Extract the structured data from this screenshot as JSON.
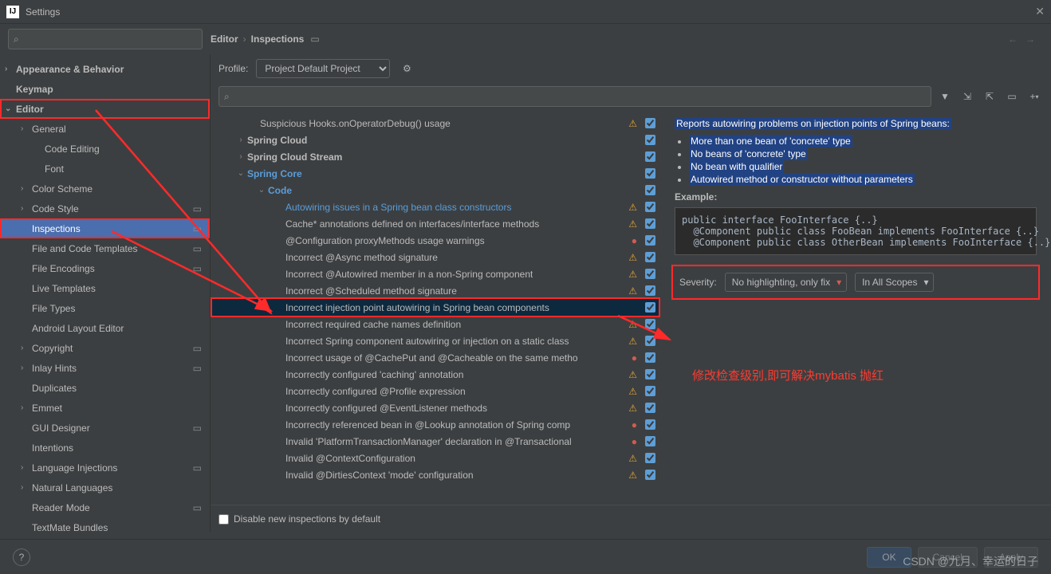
{
  "title": "Settings",
  "breadcrumbs": {
    "a": "Editor",
    "b": "Inspections"
  },
  "profile": {
    "label": "Profile:",
    "selected": "Project Default  Project"
  },
  "sidebar": {
    "items": [
      {
        "label": "Appearance & Behavior",
        "bold": true,
        "chev": ">"
      },
      {
        "label": "Keymap",
        "bold": true
      },
      {
        "label": "Editor",
        "bold": true,
        "chev": "v",
        "red": true
      },
      {
        "label": "General",
        "sub": 1,
        "chev": ">"
      },
      {
        "label": "Code Editing",
        "sub": 2
      },
      {
        "label": "Font",
        "sub": 2
      },
      {
        "label": "Color Scheme",
        "sub": 1,
        "chev": ">"
      },
      {
        "label": "Code Style",
        "sub": 1,
        "chev": ">",
        "gear": true
      },
      {
        "label": "Inspections",
        "sub": 1,
        "selected": true,
        "red": true,
        "gear": true
      },
      {
        "label": "File and Code Templates",
        "sub": 1,
        "gear": true
      },
      {
        "label": "File Encodings",
        "sub": 1,
        "gear": true
      },
      {
        "label": "Live Templates",
        "sub": 1
      },
      {
        "label": "File Types",
        "sub": 1
      },
      {
        "label": "Android Layout Editor",
        "sub": 1
      },
      {
        "label": "Copyright",
        "sub": 1,
        "chev": ">",
        "gear": true
      },
      {
        "label": "Inlay Hints",
        "sub": 1,
        "chev": ">",
        "gear": true
      },
      {
        "label": "Duplicates",
        "sub": 1
      },
      {
        "label": "Emmet",
        "sub": 1,
        "chev": ">"
      },
      {
        "label": "GUI Designer",
        "sub": 1,
        "gear": true
      },
      {
        "label": "Intentions",
        "sub": 1
      },
      {
        "label": "Language Injections",
        "sub": 1,
        "chev": ">",
        "gear": true
      },
      {
        "label": "Natural Languages",
        "sub": 1,
        "chev": ">"
      },
      {
        "label": "Reader Mode",
        "sub": 1,
        "gear": true
      },
      {
        "label": "TextMate Bundles",
        "sub": 1
      }
    ]
  },
  "tree": [
    {
      "label": "Suspicious Hooks.onOperatorDebug() usage",
      "pad": 1,
      "badge": "warn",
      "chk": true
    },
    {
      "label": "Spring Cloud",
      "pad": 0,
      "bold": true,
      "chev": ">",
      "chk": true
    },
    {
      "label": "Spring Cloud Stream",
      "pad": 0,
      "bold": true,
      "chev": ">",
      "chk": true
    },
    {
      "label": "Spring Core",
      "pad": 0,
      "bold": true,
      "chev": "v",
      "link": true,
      "chk": true
    },
    {
      "label": "Code",
      "pad": 4,
      "bold": true,
      "chev": "v",
      "link": true,
      "chk": true
    },
    {
      "label": "Autowiring issues in a Spring bean class constructors",
      "pad": 3,
      "link": true,
      "badge": "warn",
      "chk": true
    },
    {
      "label": "Cache* annotations defined on interfaces/interface methods",
      "pad": 3,
      "badge": "warn",
      "chk": true
    },
    {
      "label": "@Configuration proxyMethods usage warnings",
      "pad": 3,
      "badge": "err",
      "chk": true
    },
    {
      "label": "Incorrect @Async method signature",
      "pad": 3,
      "badge": "warn",
      "chk": true
    },
    {
      "label": "Incorrect @Autowired member in a non-Spring component",
      "pad": 3,
      "badge": "warn",
      "chk": true
    },
    {
      "label": "Incorrect @Scheduled method signature",
      "pad": 3,
      "badge": "warn",
      "chk": true
    },
    {
      "label": "Incorrect injection point autowiring in Spring bean components",
      "pad": 3,
      "sel": true,
      "red": true,
      "chk": true
    },
    {
      "label": "Incorrect required cache names definition",
      "pad": 3,
      "badge": "warn",
      "chk": true
    },
    {
      "label": "Incorrect Spring component autowiring or injection on a static class",
      "pad": 3,
      "badge": "warn",
      "chk": true
    },
    {
      "label": "Incorrect usage of @CachePut and @Cacheable on the same metho",
      "pad": 3,
      "badge": "err",
      "chk": true
    },
    {
      "label": "Incorrectly configured 'caching' annotation",
      "pad": 3,
      "badge": "warn",
      "chk": true
    },
    {
      "label": "Incorrectly configured @Profile expression",
      "pad": 3,
      "badge": "warn",
      "chk": true
    },
    {
      "label": "Incorrectly configured  @EventListener methods",
      "pad": 3,
      "badge": "warn",
      "chk": true
    },
    {
      "label": "Incorrectly referenced bean in @Lookup annotation of Spring comp",
      "pad": 3,
      "badge": "err",
      "chk": true
    },
    {
      "label": "Invalid 'PlatformTransactionManager' declaration in @Transactional",
      "pad": 3,
      "badge": "err",
      "chk": true
    },
    {
      "label": "Invalid @ContextConfiguration",
      "pad": 3,
      "badge": "warn",
      "chk": true
    },
    {
      "label": "Invalid @DirtiesContext 'mode' configuration",
      "pad": 3,
      "badge": "warn",
      "chk": true
    }
  ],
  "desc": {
    "headline": "Reports autowiring problems on injection points of Spring beans:",
    "bullets": [
      "More than one bean of 'concrete' type",
      "No beans of 'concrete' type",
      "No bean with qualifier",
      "Autowired method or constructor without parameters"
    ],
    "example_label": "Example:",
    "code": "public interface FooInterface {..}\n  @Component public class FooBean implements FooInterface {..}\n  @Component public class OtherBean implements FooInterface {..}",
    "severity_label": "Severity:",
    "severity_value": "No highlighting, only fix",
    "scope_value": "In All Scopes"
  },
  "disable_label": "Disable new inspections by default",
  "buttons": {
    "ok": "OK",
    "cancel": "Cancel",
    "apply": "Apply"
  },
  "annotation": "修改检查级别,即可解决mybatis 抛红",
  "watermark": "CSDN @九月、幸运的日子"
}
